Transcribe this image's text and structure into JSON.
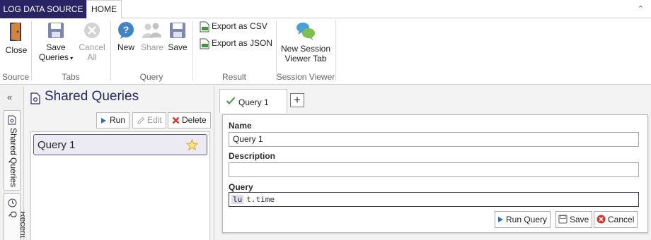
{
  "tabs": {
    "source": "LOG DATA SOURCE",
    "home": "HOME"
  },
  "ribbon": {
    "source": {
      "close": "Close",
      "group": "Source"
    },
    "tabs_group": {
      "save_line1": "Save",
      "save_line2": "Queries",
      "cancel_line1": "Cancel",
      "cancel_line2": "All",
      "group": "Tabs"
    },
    "query_group": {
      "new": "New",
      "share": "Share",
      "save": "Save",
      "group": "Query"
    },
    "result_group": {
      "export_csv": "Export as CSV",
      "export_json": "Export as JSON",
      "group": "Result"
    },
    "session_group": {
      "line1": "New Session",
      "line2": "Viewer Tab",
      "group": "Session Viewer"
    }
  },
  "rail": {
    "shared": "Shared Queries",
    "recent": "Recent Q"
  },
  "shared_queries": {
    "title": "Shared Queries",
    "run": "Run",
    "edit": "Edit",
    "delete": "Delete",
    "items": [
      {
        "label": "Query 1"
      }
    ]
  },
  "editor": {
    "tab_label": "Query 1",
    "name_label": "Name",
    "name_value": "Query 1",
    "description_label": "Description",
    "description_value": "",
    "query_label": "Query",
    "query_keyword": "lu",
    "query_rest": "t.time",
    "run_query": "Run Query",
    "save": "Save",
    "cancel": "Cancel"
  },
  "colors": {
    "accent": "#2b2464",
    "selection": "#ecebf4",
    "delete": "#d9342b",
    "check": "#3b9a3b"
  }
}
